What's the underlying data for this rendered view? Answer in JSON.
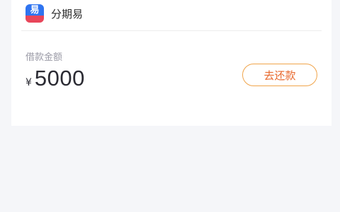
{
  "card": {
    "app": {
      "icon": "fenqiyi-app-icon",
      "icon_glyph": "易",
      "name": "分期易"
    },
    "loan": {
      "label": "借款金额",
      "currency": "¥",
      "amount": "5000"
    },
    "repay_button": "去还款"
  },
  "colors": {
    "background": "#f5f6f9",
    "card": "#ffffff",
    "button_border": "#f0a44a",
    "button_text": "#e8672b",
    "icon_blue": "#2f74f0",
    "icon_red": "#e8465a"
  }
}
